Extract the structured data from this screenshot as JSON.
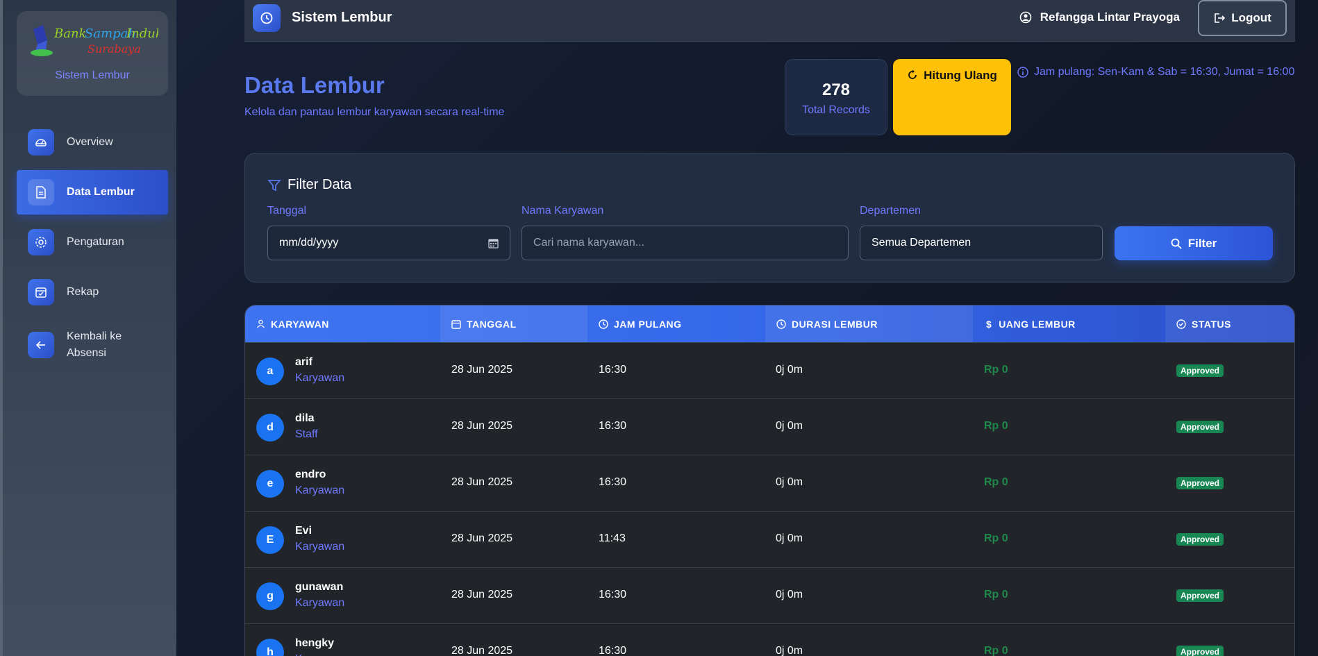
{
  "sidebar": {
    "logo_text_line1": "Bank Sampah Induk",
    "logo_text_line2": "Surabaya",
    "subtitle": "Sistem Lembur",
    "items": [
      {
        "label": "Overview",
        "icon": "gauge-icon",
        "active": false
      },
      {
        "label": "Data Lembur",
        "icon": "document-icon",
        "active": true
      },
      {
        "label": "Pengaturan",
        "icon": "gear-icon",
        "active": false
      },
      {
        "label": "Rekap",
        "icon": "calendar-check-icon",
        "active": false
      },
      {
        "label": "Kembali ke Absensi",
        "icon": "arrow-left-icon",
        "active": false
      }
    ]
  },
  "topbar": {
    "title": "Sistem Lembur",
    "user_name": "Refangga Lintar Prayoga",
    "logout_label": "Logout"
  },
  "page": {
    "title": "Data Lembur",
    "subtitle": "Kelola dan pantau lembur karyawan secara real-time",
    "stat_value": "278",
    "stat_label": "Total Records",
    "recalc_label": "Hitung Ulang",
    "info_text": "Jam pulang: Sen-Kam & Sab = 16:30, Jumat = 16:00"
  },
  "filter": {
    "title": "Filter Data",
    "date_label": "Tanggal",
    "date_value": "mm/dd/yyyy",
    "name_label": "Nama Karyawan",
    "name_placeholder": "Cari nama karyawan...",
    "dept_label": "Departemen",
    "dept_value": "Semua Departemen",
    "button_label": "Filter"
  },
  "table": {
    "headers": [
      "KARYAWAN",
      "TANGGAL",
      "JAM PULANG",
      "DURASI LEMBUR",
      "UANG LEMBUR",
      "STATUS"
    ],
    "rows": [
      {
        "initial": "a",
        "name": "arif",
        "role": "Karyawan",
        "date": "28 Jun 2025",
        "jam": "16:30",
        "durasi": "0j 0m",
        "uang": "Rp 0",
        "status": "Approved"
      },
      {
        "initial": "d",
        "name": "dila",
        "role": "Staff",
        "date": "28 Jun 2025",
        "jam": "16:30",
        "durasi": "0j 0m",
        "uang": "Rp 0",
        "status": "Approved"
      },
      {
        "initial": "e",
        "name": "endro",
        "role": "Karyawan",
        "date": "28 Jun 2025",
        "jam": "16:30",
        "durasi": "0j 0m",
        "uang": "Rp 0",
        "status": "Approved"
      },
      {
        "initial": "E",
        "name": "Evi",
        "role": "Karyawan",
        "date": "28 Jun 2025",
        "jam": "11:43",
        "durasi": "0j 0m",
        "uang": "Rp 0",
        "status": "Approved"
      },
      {
        "initial": "g",
        "name": "gunawan",
        "role": "Karyawan",
        "date": "28 Jun 2025",
        "jam": "16:30",
        "durasi": "0j 0m",
        "uang": "Rp 0",
        "status": "Approved"
      },
      {
        "initial": "h",
        "name": "hengky",
        "role": "Karyawan",
        "date": "28 Jun 2025",
        "jam": "16:30",
        "durasi": "0j 0m",
        "uang": "Rp 0",
        "status": "Approved"
      }
    ]
  },
  "colors": {
    "accent": "#3b6ce6",
    "title": "#5b79ee",
    "muted_blue": "#6f79ff",
    "warning": "#ffc107",
    "success": "#198754"
  }
}
